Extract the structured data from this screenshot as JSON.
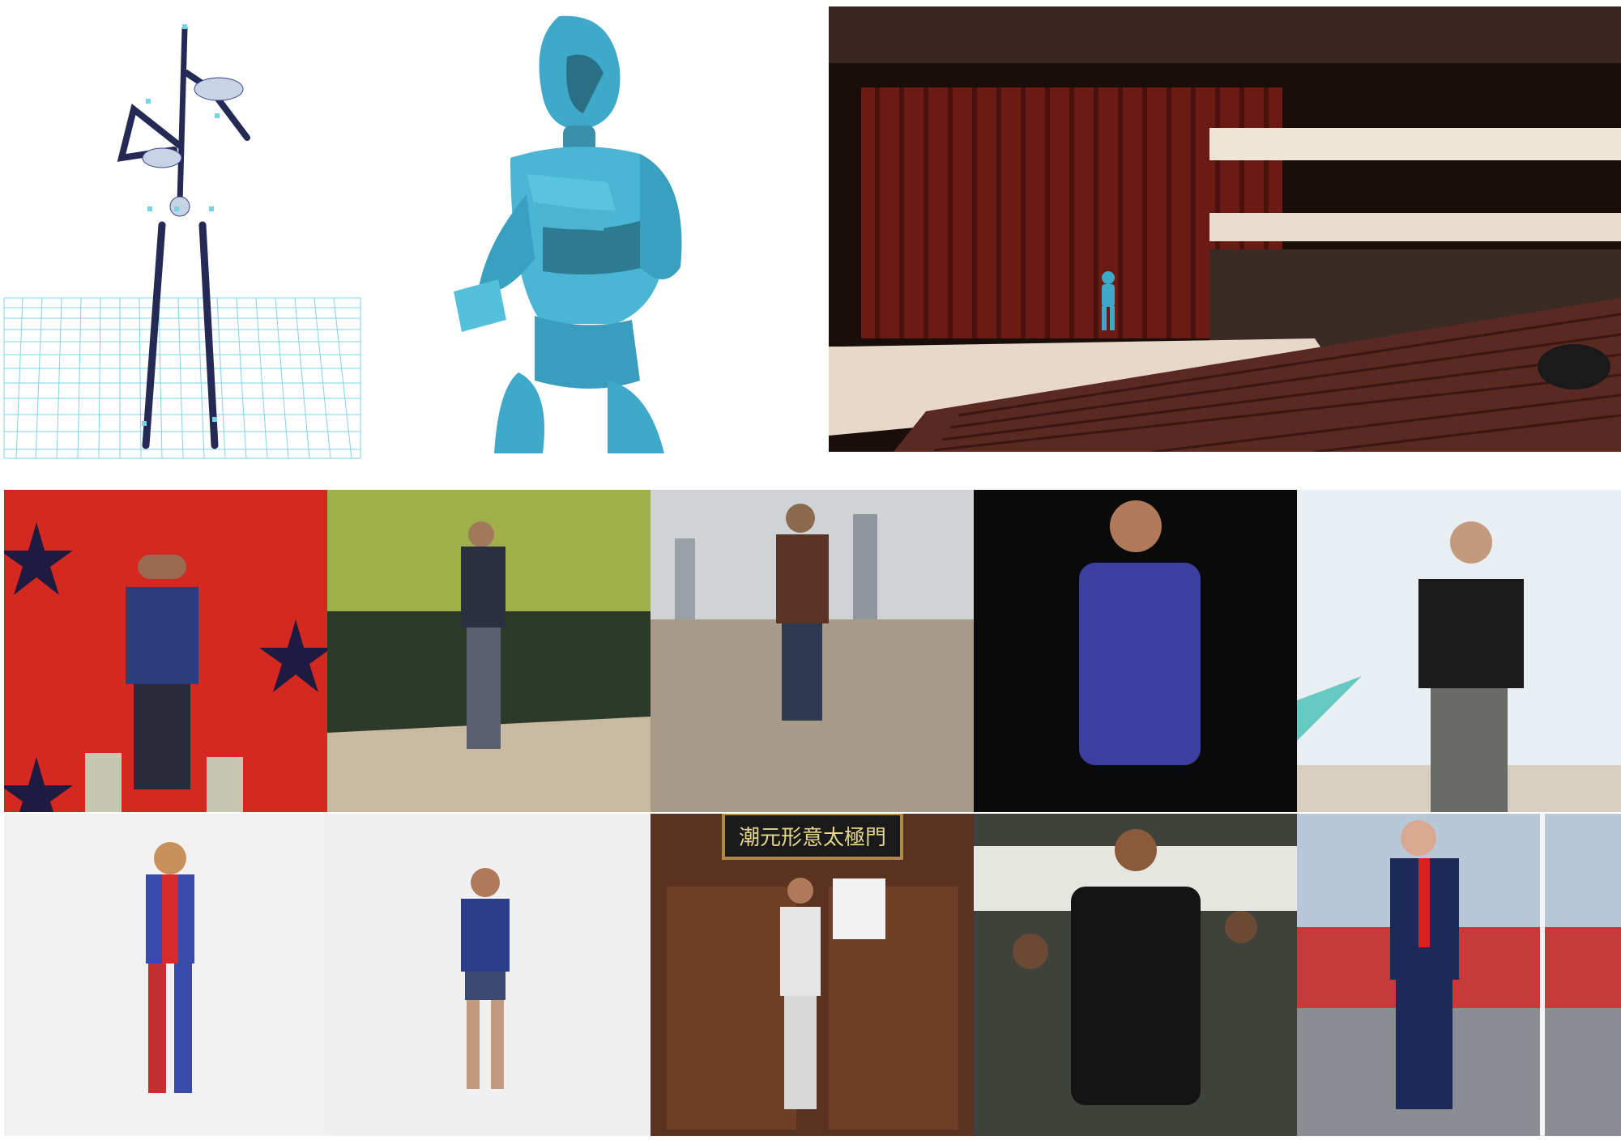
{
  "figure": {
    "top_row": [
      {
        "name": "skeleton-rig",
        "kind": "3d skeleton on grid"
      },
      {
        "name": "avatar-model",
        "kind": "3d avatar close-up"
      },
      {
        "name": "theater-stage",
        "kind": "avatar rendered on theater stage"
      }
    ],
    "grid_rows": 2,
    "grid_cols": 5,
    "sign_text": "潮元形意太極門"
  },
  "colors": {
    "avatar": "#3fa9c9",
    "skeleton": "#2a2f5a",
    "grid_line": "#6fd0e0",
    "curtain": "#6b1b14"
  }
}
